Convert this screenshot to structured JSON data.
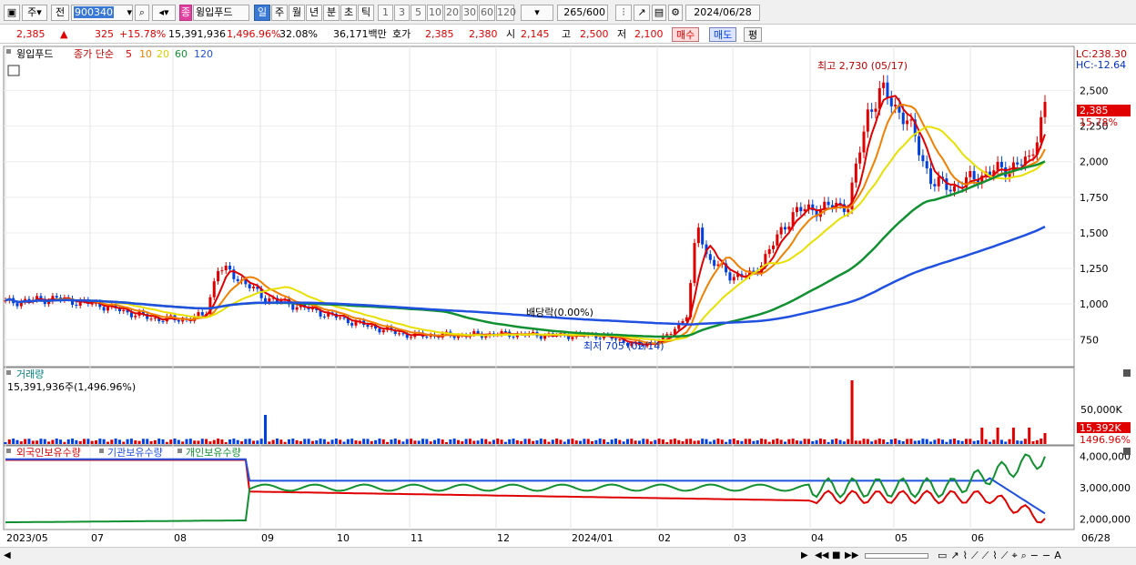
{
  "toolbar": {
    "market": "주",
    "prefix": "전",
    "code": "900340",
    "badge": "종",
    "name": "윙입푸드",
    "periods": [
      "일",
      "주",
      "월",
      "년",
      "분",
      "초",
      "틱"
    ],
    "selected_period": "일",
    "intervals": [
      "1",
      "3",
      "5",
      "10",
      "20",
      "30",
      "60",
      "120"
    ],
    "count": "265",
    "count_total": "/600",
    "date": "2024/06/28"
  },
  "quote": {
    "price": "2,385",
    "change_arrow": "▲",
    "change": "325",
    "change_pct": "+15.78%",
    "volume": "15,391,936",
    "volume_pct": "1,496.96%",
    "turnover": "32.08%",
    "amount": "36,171백만",
    "ask_label": "호가",
    "ask": "2,385",
    "bid": "2,380",
    "open_label": "시",
    "open": "2,145",
    "high_label": "고",
    "high": "2,500",
    "low_label": "저",
    "low": "2,100",
    "buy": "매수",
    "sell": "매도",
    "eval": "평"
  },
  "price_pane": {
    "title": "윙입푸드",
    "legend_label": "종가 단순",
    "ma": [
      {
        "period": "5",
        "color": "#e00000"
      },
      {
        "period": "10",
        "color": "#f08000"
      },
      {
        "period": "20",
        "color": "#e8e000"
      },
      {
        "period": "60",
        "color": "#109030"
      },
      {
        "period": "120",
        "color": "#2050e0"
      }
    ],
    "lc": "LC:238.30",
    "hc": "HC:-12.64",
    "last_price_tag": "2,385",
    "last_pct_tag": "15.78%",
    "high_annot": "최고 2,730 (05/17)",
    "low_annot": "최저 705 (02/14)",
    "dividend_annot": "배당락(0.00%)",
    "y_ticks": [
      "2,500",
      "2,250",
      "2,000",
      "1,750",
      "1,500",
      "1,250",
      "1,000",
      "750"
    ]
  },
  "volume_pane": {
    "title": "거래량",
    "value": "15,391,936주(1,496.96%)",
    "y_tick": "50,000K",
    "last_tag": "15,392K",
    "last_pct": "1496.96%"
  },
  "holding_pane": {
    "legend": [
      "외국인보유수량",
      "기관보유수량",
      "개인보유수량"
    ],
    "y_ticks": [
      "4,000,000",
      "3,000,000",
      "2,000,000"
    ]
  },
  "x_axis": [
    "2023/05",
    "07",
    "08",
    "09",
    "10",
    "11",
    "12",
    "2024/01",
    "02",
    "03",
    "04",
    "05",
    "06",
    "06/28"
  ],
  "colors": {
    "up": "#e00000",
    "down": "#0040e0"
  }
}
